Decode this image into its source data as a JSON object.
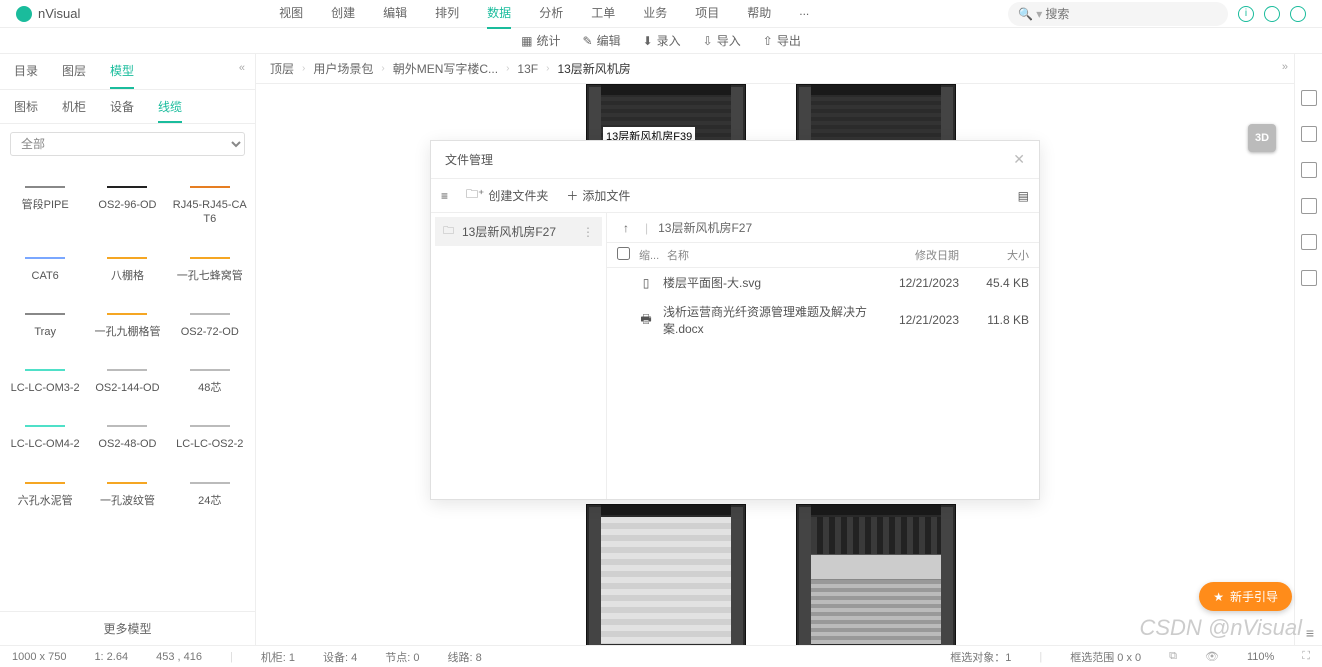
{
  "app": {
    "name": "nVisual"
  },
  "menu": [
    "视图",
    "创建",
    "编辑",
    "排列",
    "数据",
    "分析",
    "工单",
    "业务",
    "项目",
    "帮助"
  ],
  "menu_active": 4,
  "menu_extra": "...",
  "search_placeholder": "搜索",
  "subbar": [
    {
      "icon": "stats",
      "label": "统计"
    },
    {
      "icon": "edit",
      "label": "编辑"
    },
    {
      "icon": "rec",
      "label": "录入"
    },
    {
      "icon": "import",
      "label": "导入"
    },
    {
      "icon": "export",
      "label": "导出"
    }
  ],
  "left": {
    "tabs": [
      "目录",
      "图层",
      "模型"
    ],
    "tabs_active": 2,
    "subtabs": [
      "图标",
      "机柜",
      "设备",
      "线缆"
    ],
    "subtabs_active": 3,
    "filter_placeholder": "全部",
    "items": [
      {
        "label": "管段PIPE",
        "color": "#888"
      },
      {
        "label": "OS2-96-OD",
        "color": "#222"
      },
      {
        "label": "RJ45-RJ45-CAT6",
        "color": "#e67e22"
      },
      {
        "label": "CAT6",
        "color": "#7aa7ff"
      },
      {
        "label": "八棚格",
        "color": "#f5a623"
      },
      {
        "label": "一孔七蜂窝管",
        "color": "#f5a623"
      },
      {
        "label": "Tray",
        "color": "#888"
      },
      {
        "label": "一孔九棚格管",
        "color": "#f5a623"
      },
      {
        "label": "OS2-72-OD",
        "color": "#bbb"
      },
      {
        "label": "LC-LC-OM3-2",
        "color": "#4fe0c8"
      },
      {
        "label": "OS2-144-OD",
        "color": "#bbb"
      },
      {
        "label": "48芯",
        "color": "#bbb"
      },
      {
        "label": "LC-LC-OM4-2",
        "color": "#4fe0c8"
      },
      {
        "label": "OS2-48-OD",
        "color": "#bbb"
      },
      {
        "label": "LC-LC-OS2-2",
        "color": "#bbb"
      },
      {
        "label": "六孔水泥管",
        "color": "#f5a623"
      },
      {
        "label": "一孔波纹管",
        "color": "#f5a623"
      },
      {
        "label": "24芯",
        "color": "#bbb"
      }
    ],
    "more": "更多模型"
  },
  "crumbs": [
    "顶层",
    "用户场景包",
    "朝外MEN写字楼C...",
    "13F",
    "13层新风机房"
  ],
  "rack_label": "13层新风机房F39",
  "btn3d": "3D",
  "dialog": {
    "title": "文件管理",
    "new_folder": "创建文件夹",
    "add_file": "添加文件",
    "tree_item": "13层新风机房F27",
    "path": "13层新风机房F27",
    "cols": {
      "thumb": "缩...",
      "name": "名称",
      "date": "修改日期",
      "size": "大小"
    },
    "files": [
      {
        "icon": "doc",
        "name": "楼层平面图-大.svg",
        "date": "12/21/2023",
        "size": "45.4 KB"
      },
      {
        "icon": "print",
        "name": "浅析运营商光纤资源管理难题及解决方案.docx",
        "date": "12/21/2023",
        "size": "11.8 KB"
      }
    ]
  },
  "help_btn": "新手引导",
  "watermark": "CSDN @nVisual",
  "status": {
    "dims": "1000 x 750",
    "scale": "1: 2.64",
    "coord": "453 , 416",
    "cab": "机柜: 1",
    "dev": "设备: 4",
    "node": "节点: 0",
    "line": "线路: 8",
    "sel": "框选对象：1",
    "range": "框选范围  0 x 0",
    "zoom": "110%"
  }
}
